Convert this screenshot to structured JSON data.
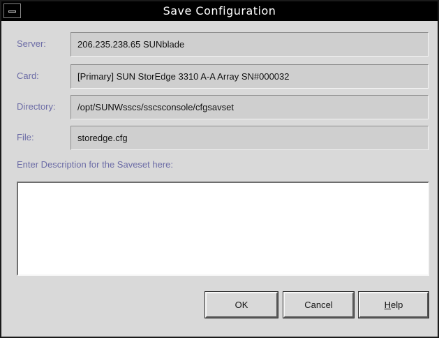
{
  "window": {
    "title": "Save Configuration"
  },
  "form": {
    "fields": [
      {
        "label": "Server:",
        "value": "206.235.238.65 SUNblade"
      },
      {
        "label": "Card:",
        "value": "[Primary] SUN StorEdge 3310 A-A Array SN#000032"
      },
      {
        "label": "Directory:",
        "value": "/opt/SUNWsscs/sscsconsole/cfgsavset"
      },
      {
        "label": "File:",
        "value": "storedge.cfg"
      }
    ],
    "description_label": "Enter Description for the Saveset here:",
    "description_value": ""
  },
  "buttons": {
    "ok": "OK",
    "cancel": "Cancel",
    "help_mnemonic": "H",
    "help_rest": "elp"
  },
  "colors": {
    "label": "#6c6ca6",
    "titlebar": "#000000",
    "background": "#d9d9d9"
  }
}
